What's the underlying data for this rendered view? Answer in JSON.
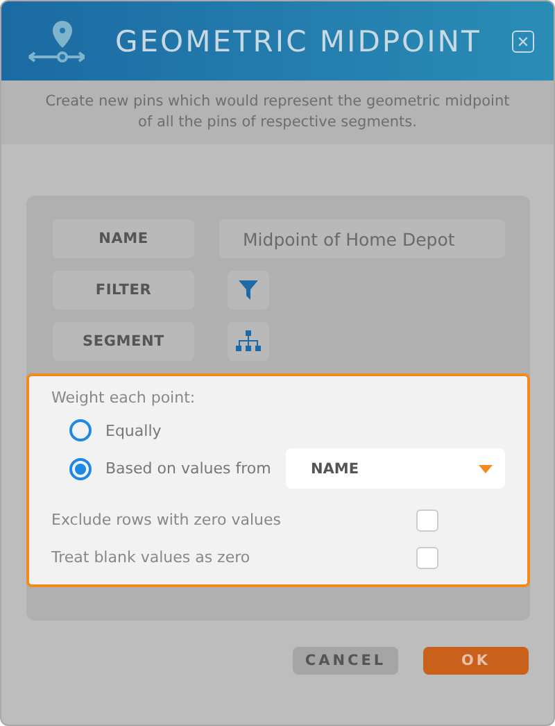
{
  "dialog": {
    "title": "GEOMETRIC MIDPOINT",
    "close": "✕",
    "description": "Create new pins which would represent the geometric midpoint of all the pins of respective segments.",
    "fields": [
      {
        "label": "NAME",
        "kind": "text",
        "value": "Midpoint of Home Depot"
      },
      {
        "label": "FILTER",
        "kind": "filter"
      },
      {
        "label": "SEGMENT",
        "kind": "segment"
      }
    ],
    "weight": {
      "label": "Weight each point:",
      "options": [
        {
          "label": "Equally",
          "selected": false
        },
        {
          "label": "Based on values from",
          "selected": true
        }
      ],
      "dropdown": "NAME"
    },
    "checkboxes": [
      {
        "label": "Exclude rows with zero values",
        "checked": false
      },
      {
        "label": "Treat blank values as zero",
        "checked": false
      }
    ],
    "buttons": [
      {
        "label": "CANCEL",
        "kind": "secondary"
      },
      {
        "label": "OK",
        "kind": "primary"
      }
    ]
  }
}
